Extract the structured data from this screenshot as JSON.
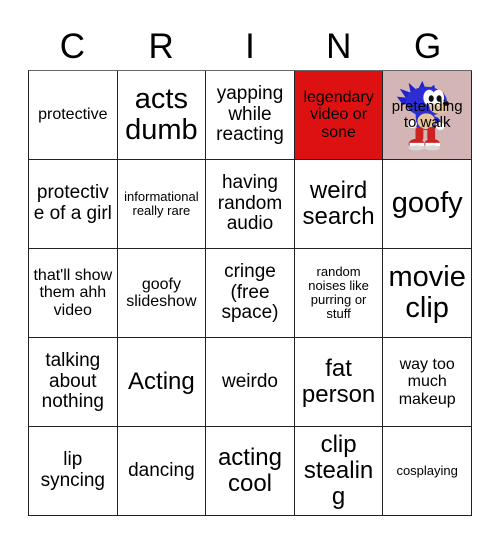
{
  "card": {
    "title_letters": [
      "C",
      "R",
      "I",
      "N",
      "G"
    ],
    "rows": [
      [
        {
          "text": "protective",
          "size": "s",
          "style": "plain"
        },
        {
          "text": "acts dumb",
          "size": "xl",
          "style": "plain"
        },
        {
          "text": "yapping while reacting",
          "size": "m",
          "style": "plain"
        },
        {
          "text": "legendary video or sone",
          "size": "s",
          "style": "red",
          "bg": "#DD1111"
        },
        {
          "text": "pretending to walk",
          "size": "s",
          "style": "sonic",
          "bg": "#d4b5b5",
          "image": "sonic-sprite"
        }
      ],
      [
        {
          "text": "protective of a girl",
          "size": "m",
          "style": "plain"
        },
        {
          "text": "informational really rare",
          "size": "xs",
          "style": "plain"
        },
        {
          "text": "having random audio",
          "size": "m",
          "style": "plain"
        },
        {
          "text": "weird search",
          "size": "l",
          "style": "plain"
        },
        {
          "text": "goofy",
          "size": "xl",
          "style": "plain"
        }
      ],
      [
        {
          "text": "that'll show them ahh video",
          "size": "s",
          "style": "plain"
        },
        {
          "text": "goofy slideshow",
          "size": "s",
          "style": "plain"
        },
        {
          "text": "cringe (free space)",
          "size": "m",
          "style": "plain"
        },
        {
          "text": "random noises like purring or stuff",
          "size": "xs",
          "style": "plain"
        },
        {
          "text": "movie clip",
          "size": "xl",
          "style": "plain"
        }
      ],
      [
        {
          "text": "talking about nothing",
          "size": "m",
          "style": "plain"
        },
        {
          "text": "Acting",
          "size": "l",
          "style": "plain"
        },
        {
          "text": "weirdo",
          "size": "m",
          "style": "plain"
        },
        {
          "text": "fat person",
          "size": "l",
          "style": "plain"
        },
        {
          "text": "way too much makeup",
          "size": "s",
          "style": "plain"
        }
      ],
      [
        {
          "text": "lip syncing",
          "size": "m",
          "style": "plain"
        },
        {
          "text": "dancing",
          "size": "m",
          "style": "plain"
        },
        {
          "text": "acting cool",
          "size": "l",
          "style": "plain"
        },
        {
          "text": "clip stealing",
          "size": "l",
          "style": "plain"
        },
        {
          "text": "cosplaying",
          "size": "xs",
          "style": "plain"
        }
      ]
    ]
  },
  "colors": {
    "page_background": "#ffffff",
    "cell_background": "#ffffff",
    "grid_line": "#222222",
    "text": "#000000",
    "marked_red": "#DD1111",
    "sonic_cell_background": "#d4b5b5",
    "sonic_body_blue": "#2222cc",
    "sonic_shoe_red": "#cc2222",
    "sonic_skin": "#e8c49a"
  }
}
